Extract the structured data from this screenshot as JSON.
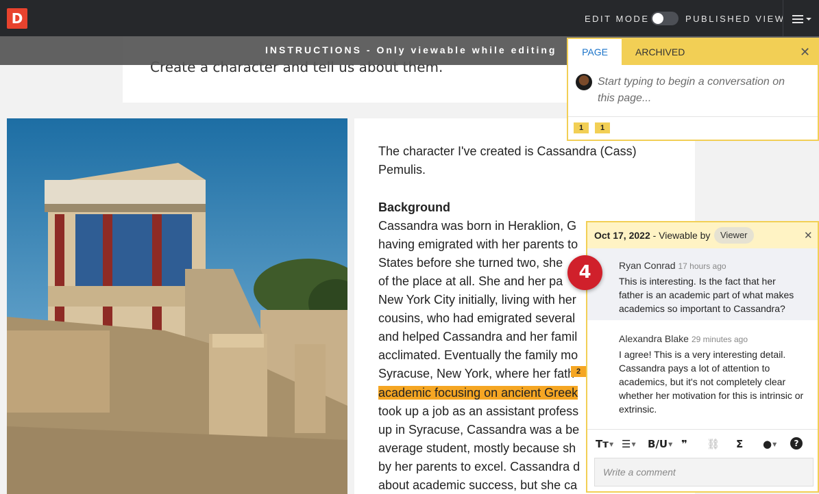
{
  "topbar": {
    "logo_letter": "D",
    "edit_mode_label": "EDIT MODE",
    "published_label": "PUBLISHED VIEW",
    "menu_icon": "hamburger-icon"
  },
  "instructions": {
    "label": "INSTRUCTIONS - Only viewable while editing",
    "prompt": "Create a character and tell us about them."
  },
  "content": {
    "intro_lines": [
      "The character I've created is Cassandra (Cass)",
      "Pemulis."
    ],
    "heading": "Background",
    "paragraph_lines": [
      "Cassandra was born in Heraklion, G",
      "having emigrated with her parents to",
      "States before she turned two, she",
      "of the place at all. She and her pa",
      "New York City initially, living with her",
      "cousins, who had emigrated several",
      "and helped Cassandra and her famil",
      "acclimated. Eventually the family mo",
      "Syracuse, New York, where her fath",
      "academic focusing on ancient Greek",
      "took up a job as an assistant profess",
      "up in Syracuse, Cassandra was a be",
      "average student, mostly because sh",
      "by her parents to excel. Cassandra d",
      "about academic success, but she ca"
    ],
    "highlight_marker": "2"
  },
  "page_panel": {
    "tab_page": "PAGE",
    "tab_archived": "ARCHIVED",
    "placeholder": "Start typing to begin a conversation on this page...",
    "flags": [
      "1",
      "1"
    ]
  },
  "thread": {
    "date": "Oct 17, 2022",
    "viewable_by": "- Viewable by",
    "viewer": "Viewer",
    "badge": "4",
    "comments": [
      {
        "author": "Ryan Conrad",
        "time": "17 hours ago",
        "text": "This is interesting. Is the fact that her father is an academic part of what makes academics so important to Cassandra?"
      },
      {
        "author": "Alexandra Blake",
        "time": "29 minutes ago",
        "text": "I agree! This is a very interesting detail. Cassandra pays a lot of attention to academics, but it's not completely clear whether her motivation for this is intrinsic or extrinsic."
      }
    ],
    "toolbar": {
      "text_size": "Tт",
      "list": "☰",
      "bold_underline": "B/U",
      "quote": "❞",
      "sigma": "Σ"
    },
    "input_placeholder": "Write a comment"
  }
}
